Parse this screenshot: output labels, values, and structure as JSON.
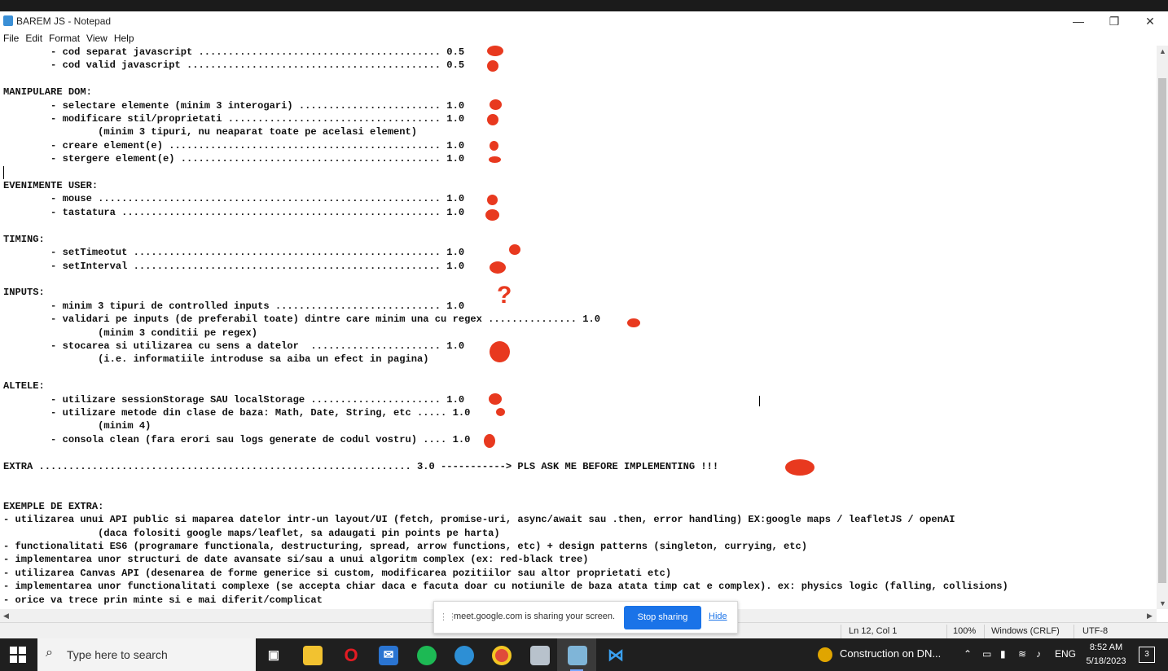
{
  "window": {
    "title": "BAREM JS - Notepad",
    "minimize_glyph": "—",
    "restore_glyph": "❐",
    "close_glyph": "✕"
  },
  "menu": [
    "File",
    "Edit",
    "Format",
    "View",
    "Help"
  ],
  "editor": {
    "lines": [
      "        - cod separat javascript ......................................... 0.5",
      "        - cod valid javascript ........................................... 0.5",
      "",
      "MANIPULARE DOM:",
      "        - selectare elemente (minim 3 interogari) ........................ 1.0",
      "        - modificare stil/proprietati .................................... 1.0",
      "                (minim 3 tipuri, nu neaparat toate pe acelasi element)",
      "        - creare element(e) .............................................. 1.0",
      "        - stergere element(e) ............................................ 1.0",
      "",
      "EVENIMENTE USER:",
      "        - mouse .......................................................... 1.0",
      "        - tastatura ...................................................... 1.0",
      "",
      "TIMING:",
      "        - setTimeotut .................................................... 1.0",
      "        - setInterval .................................................... 1.0",
      "",
      "INPUTS:",
      "        - minim 3 tipuri de controlled inputs ............................ 1.0",
      "        - validari pe inputs (de preferabil toate) dintre care minim una cu regex ............... 1.0",
      "                (minim 3 conditii pe regex)",
      "        - stocarea si utilizarea cu sens a datelor  ...................... 1.0",
      "                (i.e. informatiile introduse sa aiba un efect in pagina)",
      "",
      "ALTELE:",
      "        - utilizare sessionStorage SAU localStorage ...................... 1.0",
      "        - utilizare metode din clase de baza: Math, Date, String, etc ..... 1.0",
      "                (minim 4)",
      "        - consola clean (fara erori sau logs generate de codul vostru) .... 1.0",
      "",
      "EXTRA ............................................................... 3.0 -----------> PLS ASK ME BEFORE IMPLEMENTING !!!",
      "",
      "",
      "EXEMPLE DE EXTRA:",
      "- utilizarea unui API public si maparea datelor intr-un layout/UI (fetch, promise-uri, async/await sau .then, error handling) EX:google maps / leafletJS / openAI",
      "                (daca folositi google maps/leaflet, sa adaugati pin points pe harta)",
      "- functionalitati ES6 (programare functionala, destructuring, spread, arrow functions, etc) + design patterns (singleton, currying, etc)",
      "- implementarea unor structuri de date avansate si/sau a unui algoritm complex (ex: red-black tree)",
      "- utilizarea Canvas API (desenarea de forme generice si custom, modificarea pozitiilor sau altor proprietati etc)",
      "- implementarea unor functionalitati complexe (se accepta chiar daca e facuta doar cu notiunile de baza atata timp cat e complex). ex: physics logic (falling, collisions)",
      "- orice va trece prin minte si e mai diferit/complicat"
    ]
  },
  "annotations": {
    "color": "#e8391f",
    "question_mark": "?"
  },
  "status": {
    "position": "Ln 12, Col 1",
    "zoom": "100%",
    "line_ending": "Windows (CRLF)",
    "encoding": "UTF-8"
  },
  "share_bar": {
    "handle": "⋮⋮",
    "message": "meet.google.com is sharing your screen.",
    "stop_label": "Stop sharing",
    "hide_label": "Hide"
  },
  "taskbar": {
    "search_placeholder": "Type here to search",
    "news_text": "Construction on DN...",
    "language": "ENG",
    "time": "8:52 AM",
    "date": "5/18/2023",
    "notification_count": "3"
  }
}
